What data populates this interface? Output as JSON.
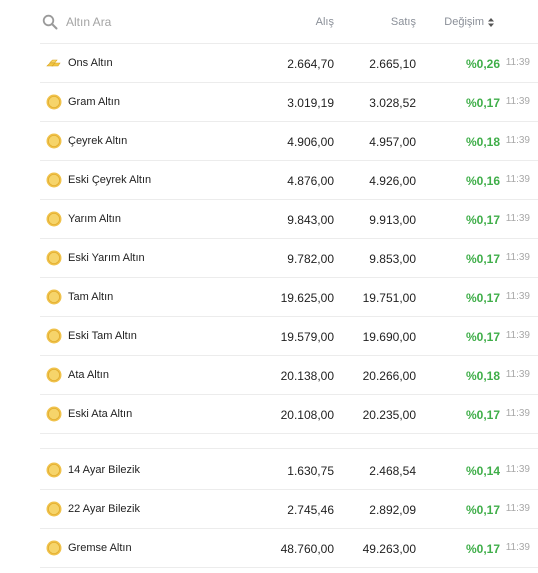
{
  "search": {
    "placeholder": "Altın Ara"
  },
  "columns": {
    "alis": "Alış",
    "satis": "Satış",
    "degisim": "Değişim"
  },
  "colors": {
    "positive": "#3fae49",
    "coin": "#f0c24b",
    "muted": "#a8a8a8"
  },
  "rows": [
    {
      "name": "Ons Altın",
      "alis": "2.664,70",
      "satis": "2.665,10",
      "change": "%0,26",
      "time": "11:39",
      "icon": "gold-bars-icon"
    },
    {
      "name": "Gram Altın",
      "alis": "3.019,19",
      "satis": "3.028,52",
      "change": "%0,17",
      "time": "11:39",
      "icon": "gold-coin-icon"
    },
    {
      "name": "Çeyrek Altın",
      "alis": "4.906,00",
      "satis": "4.957,00",
      "change": "%0,18",
      "time": "11:39",
      "icon": "gold-coin-icon"
    },
    {
      "name": "Eski Çeyrek Altın",
      "alis": "4.876,00",
      "satis": "4.926,00",
      "change": "%0,16",
      "time": "11:39",
      "icon": "gold-coin-icon"
    },
    {
      "name": "Yarım Altın",
      "alis": "9.843,00",
      "satis": "9.913,00",
      "change": "%0,17",
      "time": "11:39",
      "icon": "gold-coin-icon"
    },
    {
      "name": "Eski Yarım Altın",
      "alis": "9.782,00",
      "satis": "9.853,00",
      "change": "%0,17",
      "time": "11:39",
      "icon": "gold-coin-icon"
    },
    {
      "name": "Tam Altın",
      "alis": "19.625,00",
      "satis": "19.751,00",
      "change": "%0,17",
      "time": "11:39",
      "icon": "gold-coin-icon"
    },
    {
      "name": "Eski Tam Altın",
      "alis": "19.579,00",
      "satis": "19.690,00",
      "change": "%0,17",
      "time": "11:39",
      "icon": "gold-coin-icon"
    },
    {
      "name": "Ata Altın",
      "alis": "20.138,00",
      "satis": "20.266,00",
      "change": "%0,18",
      "time": "11:39",
      "icon": "gold-coin-icon"
    },
    {
      "name": "Eski Ata Altın",
      "alis": "20.108,00",
      "satis": "20.235,00",
      "change": "%0,17",
      "time": "11:39",
      "icon": "gold-coin-icon"
    },
    {
      "name": "14 Ayar Bilezik",
      "alis": "1.630,75",
      "satis": "2.468,54",
      "change": "%0,14",
      "time": "11:39",
      "icon": "gold-coin-icon"
    },
    {
      "name": "22 Ayar Bilezik",
      "alis": "2.745,46",
      "satis": "2.892,09",
      "change": "%0,17",
      "time": "11:39",
      "icon": "gold-coin-icon"
    },
    {
      "name": "Gremse Altın",
      "alis": "48.760,00",
      "satis": "49.263,00",
      "change": "%0,17",
      "time": "11:39",
      "icon": "gold-coin-icon"
    }
  ]
}
